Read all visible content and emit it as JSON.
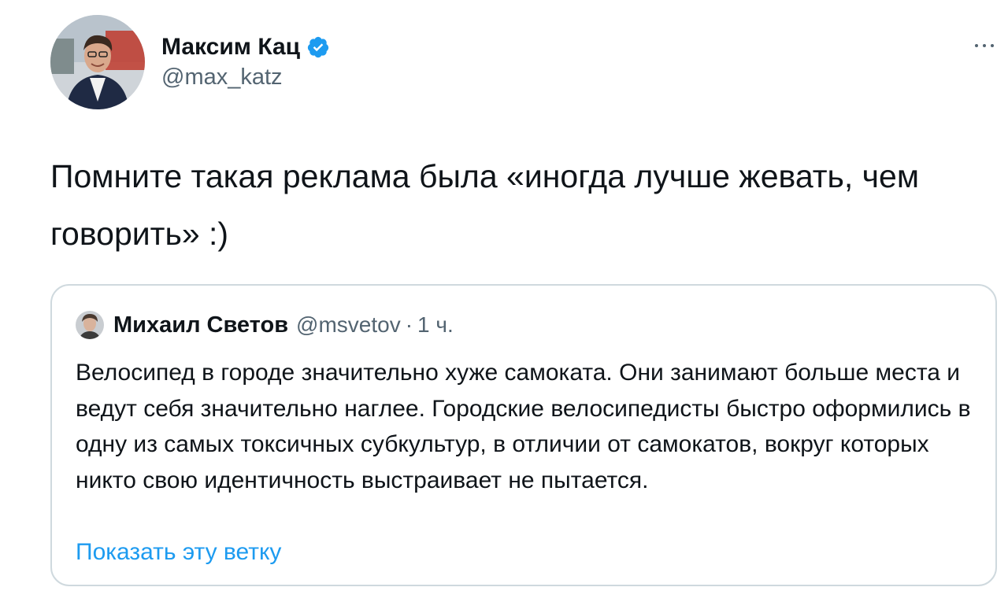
{
  "tweet": {
    "author_name": "Максим Кац",
    "author_handle": "@max_katz",
    "verified_icon": "verified-badge-icon",
    "more_icon": "more-horizontal-icon",
    "text": "Помните такая реклама была «иногда лучше жевать, чем говорить» :)"
  },
  "quote": {
    "author_name": "Михаил Светов",
    "author_handle": "@msvetov",
    "separator": "·",
    "time": "1 ч.",
    "text": "Велосипед в городе значительно хуже самоката. Они занимают больше места и ведут себя значительно наглее. Городские велосипедисты быстро оформились в одну из самых токсичных субкультур, в отличии от самокатов, вокруг которых никто свою идентичность выстраивает не пытается.",
    "show_thread": "Показать эту ветку"
  },
  "colors": {
    "accent": "#1d9bf0",
    "text_primary": "#0f1419",
    "text_secondary": "#536471",
    "border": "#cfd9de"
  }
}
